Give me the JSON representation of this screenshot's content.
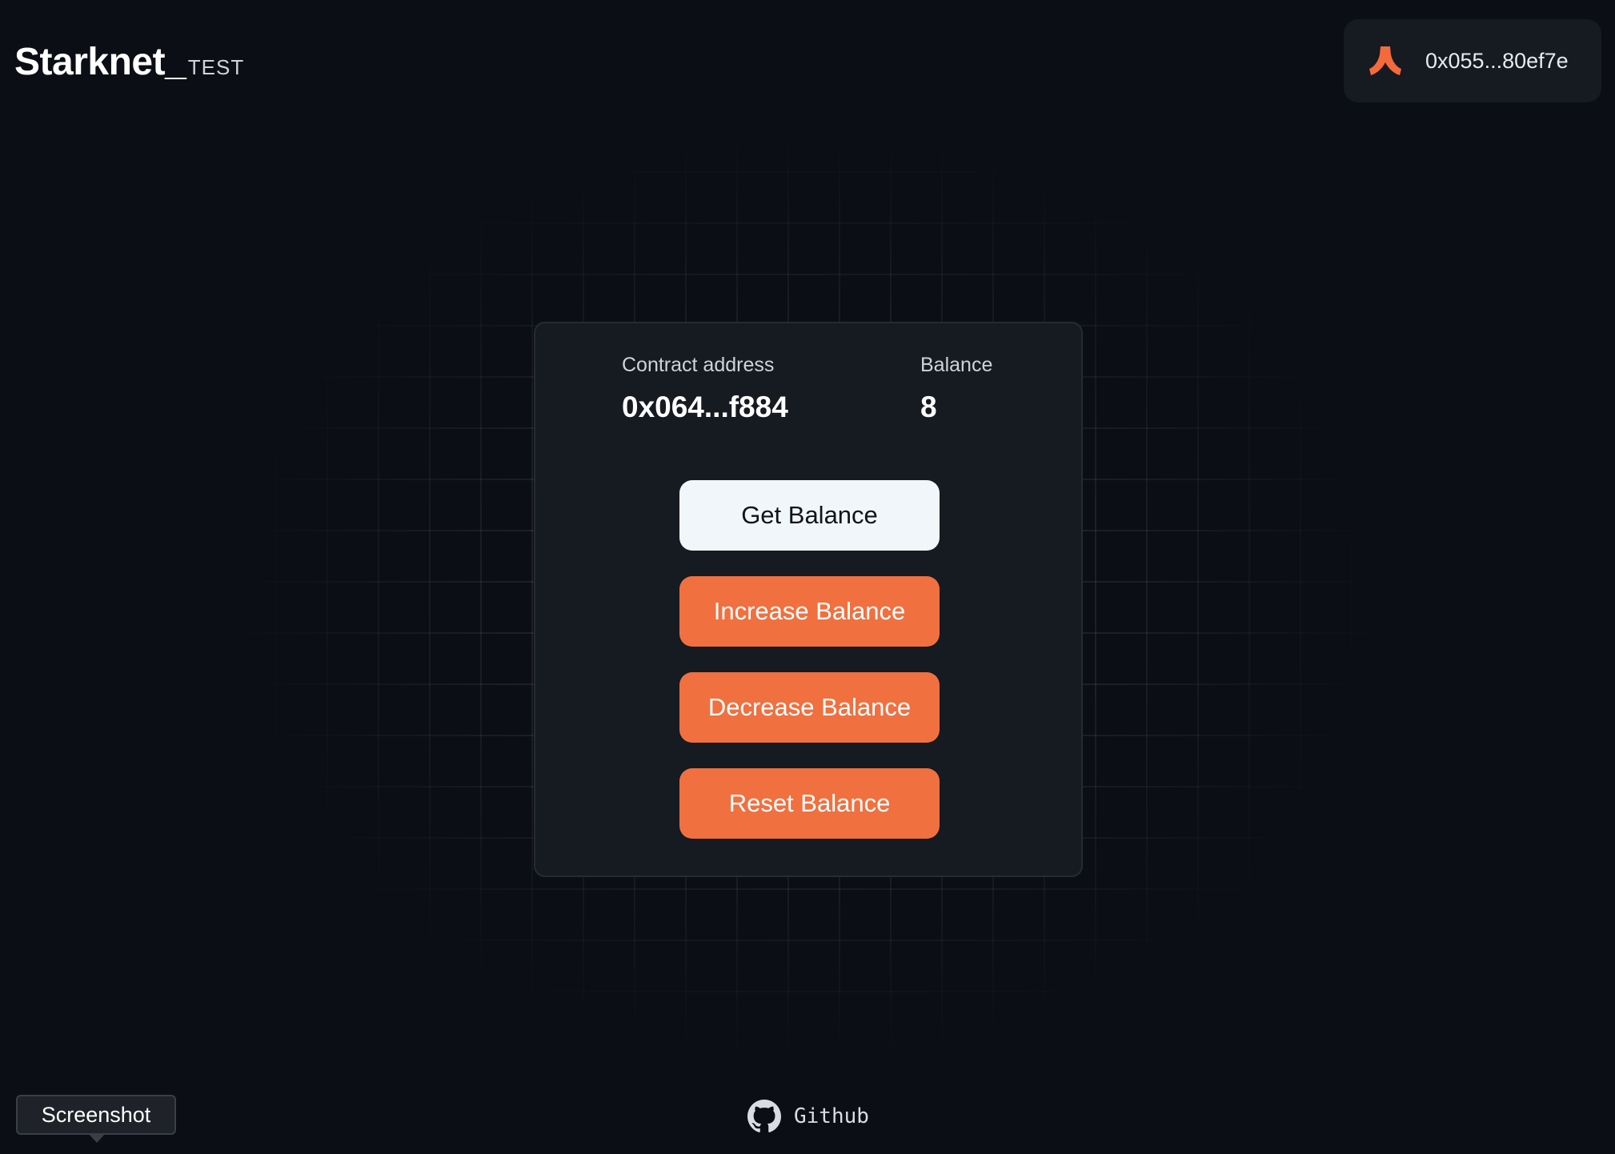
{
  "header": {
    "brand_name": "Starknet",
    "brand_underscore": "_",
    "brand_suffix": "TEST"
  },
  "wallet": {
    "address": "0x055...80ef7e",
    "icon": "argent-wallet-icon",
    "icon_color": "#f36a3d"
  },
  "card": {
    "contract_label": "Contract address",
    "contract_value": "0x064...f884",
    "balance_label": "Balance",
    "balance_value": "8"
  },
  "buttons": {
    "get_balance": "Get Balance",
    "increase_balance": "Increase Balance",
    "decrease_balance": "Decrease Balance",
    "reset_balance": "Reset Balance"
  },
  "footer": {
    "github_label": "Github",
    "github_icon": "github-icon"
  },
  "tooltip": {
    "label": "Screenshot"
  },
  "colors": {
    "background": "#0b0e14",
    "card": "#161a21",
    "accent": "#f07040",
    "light_button": "#f1f6fa"
  }
}
